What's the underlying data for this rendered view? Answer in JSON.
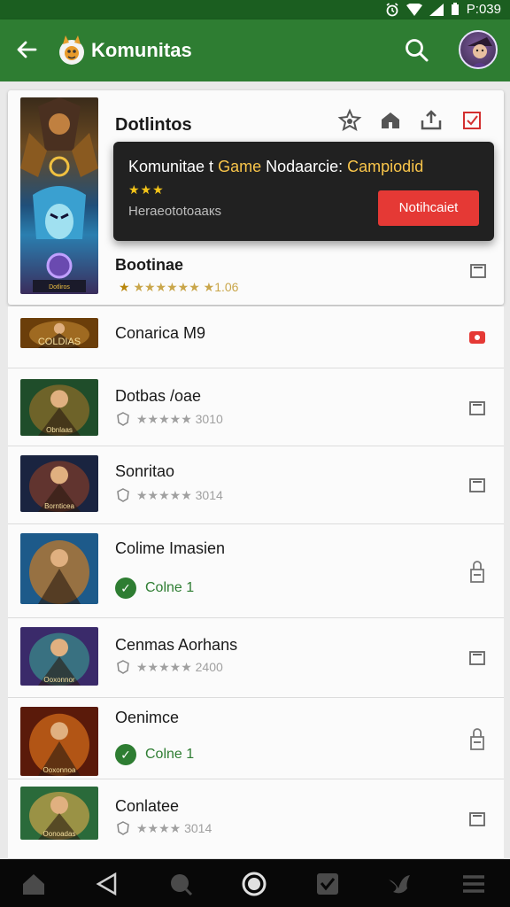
{
  "status_bar": {
    "time": "P:039",
    "icons": [
      "alarm-icon",
      "wifi-icon",
      "signal-icon",
      "battery-icon"
    ]
  },
  "app_bar": {
    "title": "Komunitas",
    "back_icon": "arrow-left-icon",
    "search_icon": "search-icon",
    "avatar_icon": "profile-avatar"
  },
  "featured": {
    "title": "Dotlintos",
    "actions": [
      "star-badge-icon",
      "home-icon",
      "upload-icon",
      "check-box-icon"
    ],
    "art_label": "Dotliros",
    "popup": {
      "title_part1": "Komunitae t ",
      "title_highlight": "Game",
      "title_part2": " Nodaarcie: ",
      "title_highlight2": "Campiodid",
      "stars": "★★★",
      "subtitle": "Hеrаеоtоtоаaкs",
      "button": "Notihcaiet"
    },
    "subtitle": "Bootinae",
    "rating_star": "★",
    "rating_text": "★★★★★★ ★1.06",
    "side_icon": "screen-icon"
  },
  "games": [
    {
      "title": "Conarica M9",
      "thumb_label": "COLDIAS",
      "icon": "red-badge-icon",
      "colors": [
        "#6b3e0a",
        "#b07a2a"
      ]
    },
    {
      "title": "Dotbas /oae",
      "thumb_label": "Obnlaas",
      "rating": "★★★★★  3010",
      "icon": "screen-icon",
      "colors": [
        "#1f4d2a",
        "#8a6b2a"
      ]
    },
    {
      "title": "Sonritao",
      "thumb_label": "Bornticea",
      "rating": "★★★★★  3014",
      "icon": "screen-icon",
      "colors": [
        "#1a2440",
        "#7a3a2a"
      ]
    },
    {
      "title": "Colime Imasien",
      "thumb_label": "",
      "status": "Colne 1",
      "icon": "lock-icon",
      "colors": [
        "#1d5a8a",
        "#c07a2a"
      ]
    },
    {
      "title": "Cenmas Aorhans",
      "thumb_label": "Ooxonnor",
      "rating": "★★★★★  2400",
      "icon": "screen-icon",
      "colors": [
        "#3a2a6a",
        "#3a8a8a"
      ]
    },
    {
      "title": "Oenimce",
      "thumb_label": "Ooxonnoa",
      "status": "Colne 1",
      "icon": "lock-icon",
      "colors": [
        "#5a1a0a",
        "#d06a1a"
      ]
    },
    {
      "title": "Conlatee",
      "thumb_label": "Oonoadas",
      "rating": "★★★★  3014",
      "icon": "screen-icon",
      "colors": [
        "#2a6a3a",
        "#c0a04a"
      ]
    }
  ],
  "nav_bar": {
    "icons": [
      "home-icon",
      "back-triangle-icon",
      "search-icon",
      "home-circle-icon",
      "check-square-icon",
      "bird-icon",
      "menu-icon"
    ]
  },
  "colors": {
    "app_bar": "#2e7d32",
    "status_bar": "#1b5e20",
    "accent_red": "#e53935",
    "popup_bg": "#212121",
    "highlight": "#f9c54a"
  }
}
